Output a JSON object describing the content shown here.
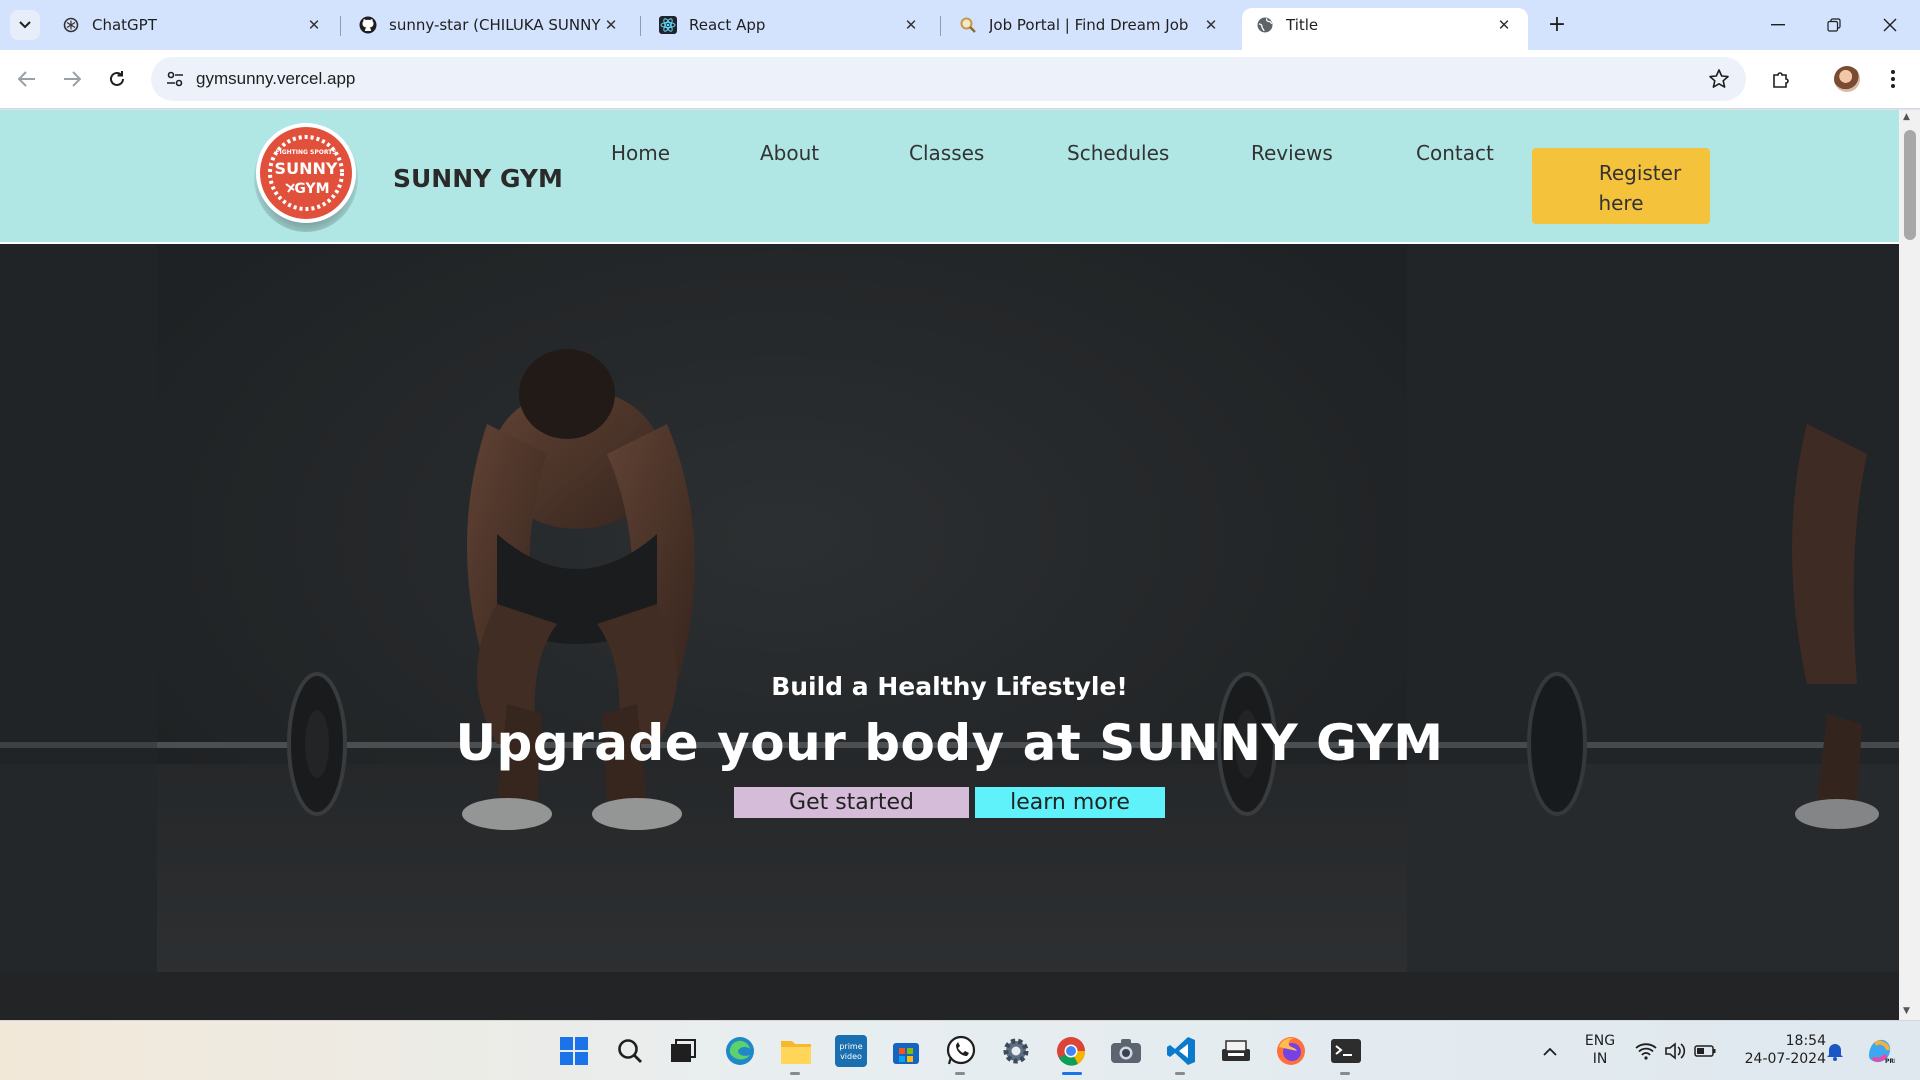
{
  "browser": {
    "tabs": [
      {
        "label": "ChatGPT",
        "icon": "chatgpt-icon"
      },
      {
        "label": "sunny-star (CHILUKA SUNNY)",
        "icon": "github-icon"
      },
      {
        "label": "React App",
        "icon": "react-icon"
      },
      {
        "label": "Job Portal | Find Dream Job",
        "icon": "search-icon"
      },
      {
        "label": "Title",
        "icon": "globe-icon",
        "active": true
      }
    ],
    "url": "gymsunny.vercel.app"
  },
  "site": {
    "brand": "SUNNY GYM",
    "logo": {
      "top_text": "FIGHTING SPORTS",
      "line1": "SUNNY",
      "line2": "GYM",
      "color": "#e0503a"
    },
    "nav": [
      "Home",
      "About",
      "Classes",
      "Schedules",
      "Reviews",
      "Contact"
    ],
    "register": {
      "line1": "Register",
      "line2": "here"
    },
    "header_bg": "#b0e6e4",
    "accent": "#f5c33b"
  },
  "hero": {
    "subtitle": "Build a Healthy Lifestyle!",
    "title": "Upgrade your body at SUNNY GYM",
    "get_started": "Get started",
    "learn_more": "learn more"
  },
  "taskbar": {
    "lang_line1": "ENG",
    "lang_line2": "IN",
    "time": "18:54",
    "date": "24-07-2024"
  }
}
